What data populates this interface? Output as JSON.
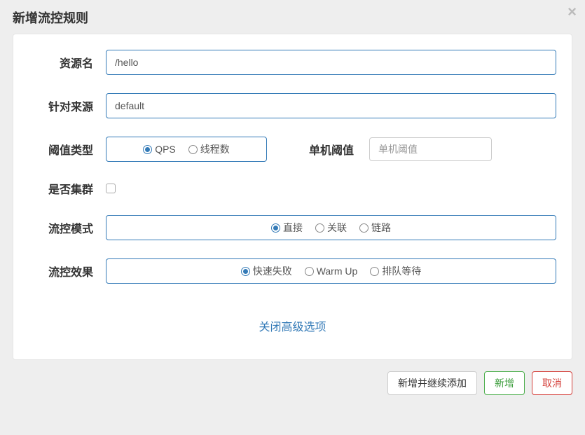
{
  "modal": {
    "title": "新增流控规则",
    "close_advanced_link": "关闭高级选项"
  },
  "form": {
    "resource_label": "资源名",
    "resource_value": "/hello",
    "source_label": "针对来源",
    "source_value": "default",
    "threshold_type_label": "阈值类型",
    "threshold_type_options": {
      "qps": "QPS",
      "threads": "线程数"
    },
    "threshold_type_selected": "qps",
    "single_threshold_label": "单机阈值",
    "single_threshold_placeholder": "单机阈值",
    "single_threshold_value": "",
    "cluster_label": "是否集群",
    "cluster_checked": false,
    "mode_label": "流控模式",
    "mode_options": {
      "direct": "直接",
      "relate": "关联",
      "chain": "链路"
    },
    "mode_selected": "direct",
    "effect_label": "流控效果",
    "effect_options": {
      "fast_fail": "快速失败",
      "warm_up": "Warm Up",
      "queue": "排队等待"
    },
    "effect_selected": "fast_fail"
  },
  "footer": {
    "add_continue": "新增并继续添加",
    "add": "新增",
    "cancel": "取消"
  }
}
